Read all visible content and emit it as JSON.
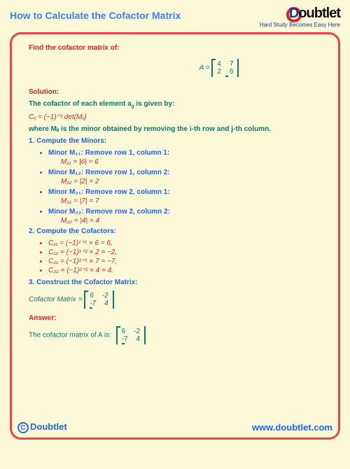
{
  "header": {
    "title": "How to Calculate the Cofactor Matrix",
    "logo_main": "Doubtlet",
    "tagline": "Hard Study Becomes Easy Here"
  },
  "problem": {
    "prompt": "Find the cofactor matrix of:",
    "A_label": "A =",
    "A": [
      [
        4,
        7
      ],
      [
        2,
        6
      ]
    ]
  },
  "solution": {
    "heading": "Solution:",
    "intro": "The cofactor of each element a",
    "intro_sub": "ij",
    "intro2": " is given by:",
    "formula": "Cᵢⱼ = (−1)ⁱ⁺ʲ det(Mᵢⱼ)",
    "where": "where Mᵢⱼ is the minor obtained by removing the i-th row and j-th column.",
    "step1_h": "1. Compute the Minors:",
    "minors": [
      {
        "label": "Minor M₁₁: Remove row 1, column 1:",
        "calc": "M₁₁ = |6| = 6"
      },
      {
        "label": "Minor M₁₂: Remove row 1, column 2:",
        "calc": "M₁₂ = |2| = 2"
      },
      {
        "label": "Minor M₂₁: Remove row 2, column 1:",
        "calc": "M₂₁ = |7| = 7"
      },
      {
        "label": "Minor M₂₂: Remove row 2, column 2:",
        "calc": "M₂₂ = |4| = 4"
      }
    ],
    "step2_h": "2. Compute the Cofactors:",
    "cofactors": [
      "C₁₁ = (−1)¹⁺¹ × 6 = 6,",
      "C₁₂ = (−1)¹⁺² × 2 = −2,",
      "C₂₁ = (−1)²⁺¹ × 7 = −7,",
      "C₂₂ = (−1)²⁺² × 4 = 4."
    ],
    "step3_h": "3. Construct the Cofactor Matrix:",
    "cof_label": "Cofactor Matrix =",
    "cof": [
      [
        6,
        -2
      ],
      [
        -7,
        4
      ]
    ],
    "answer_h": "Answer:",
    "answer_text": "The cofactor matrix of A is:"
  },
  "footer": {
    "brand": "Doubtlet",
    "url": "www.doubtlet.com",
    "copyright": "C"
  }
}
